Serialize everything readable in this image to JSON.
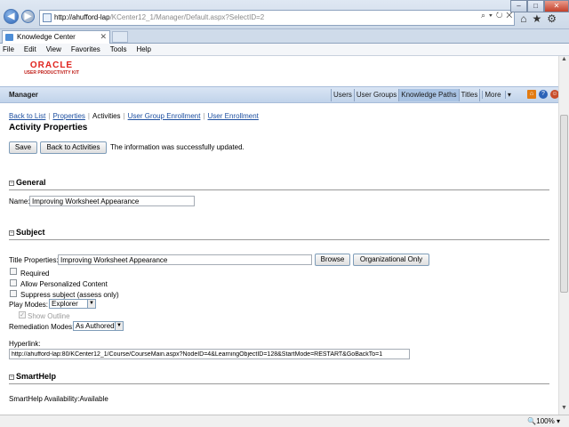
{
  "browser": {
    "address_host": "http://ahufford-lap",
    "address_path": "/KCenter12_1/Manager/Default.aspx?SelectID=2",
    "tab_title": "Knowledge Center",
    "menu": [
      "File",
      "Edit",
      "View",
      "Favorites",
      "Tools",
      "Help"
    ],
    "zoom": "100%"
  },
  "brand": {
    "oracle": "ORACLE",
    "product": "USER PRODUCTIVITY KIT"
  },
  "header": {
    "title": "Manager",
    "nav": [
      "Users",
      "User Groups",
      "Knowledge Paths",
      "Titles",
      "More"
    ]
  },
  "subnav": {
    "back_to_list": "Back to List",
    "properties": "Properties",
    "activities": "Activities",
    "user_group_enrollment": "User Group Enrollment",
    "user_enrollment": "User Enrollment"
  },
  "page": {
    "title": "Activity Properties",
    "save_label": "Save",
    "back_label": "Back to Activities",
    "message": "The information was successfully updated."
  },
  "general": {
    "heading": "General",
    "name_label": "Name:",
    "name_value": "Improving Worksheet Appearance"
  },
  "subject": {
    "heading": "Subject",
    "title_label": "Title Properties:",
    "title_value": "Improving Worksheet Appearance",
    "browse_label": "Browse",
    "org_only_label": "Organizational Only",
    "required_label": "Required",
    "allow_personalized_label": "Allow Personalized Content",
    "suppress_label": "Suppress subject (assess only)",
    "play_modes_label": "Play Modes:",
    "play_modes_value": "Explorer",
    "show_outline_label": "Show Outline",
    "remediation_label": "Remediation Modes:",
    "remediation_value": "As Authored",
    "hyperlink_label": "Hyperlink:",
    "hyperlink_value": "http://ahufford-lap:80/KCenter12_1/Course/CourseMain.aspx?NodeID=4&LearningObjectID=128&StartMode=RESTART&GoBackTo=1"
  },
  "smarthelp": {
    "heading": "SmartHelp",
    "availability_label": "SmartHelp Availability:",
    "availability_value": "Available"
  }
}
